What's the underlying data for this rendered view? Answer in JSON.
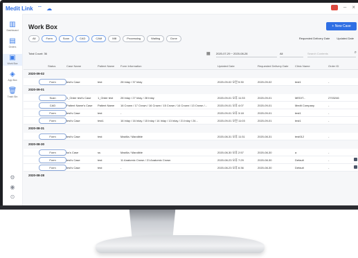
{
  "app": {
    "title": "Medit Link"
  },
  "window": {
    "badge": "!",
    "minimize": "–",
    "close": "×"
  },
  "sidebar": {
    "items": [
      {
        "icon": "dashboard-icon",
        "label": "Dashboard"
      },
      {
        "icon": "orders-icon",
        "label": "Orders"
      },
      {
        "icon": "work-box-icon",
        "label": "Work Box"
      },
      {
        "icon": "app-box-icon",
        "label": "App Box"
      },
      {
        "icon": "trash-icon",
        "label": "Trash Bin"
      }
    ]
  },
  "page": {
    "title": "Work Box",
    "new_case_label": "+ New Case"
  },
  "filters": [
    "All",
    "Form",
    "Scan",
    "CAD",
    "CAM",
    "Mill",
    "Processing",
    "Waiting",
    "Done"
  ],
  "sort": {
    "delivery": "Requested Delivery Date",
    "updated": "Updated Date"
  },
  "toolbar": {
    "total_count": "Total Count: 36",
    "date_range": "2020-07-29 ~ 2020-08-28",
    "scope": "All",
    "search_placeholder": "Search Contents"
  },
  "columns": [
    "Status",
    "Case Name",
    "Patient Name",
    "Form Information",
    "Updated Date",
    "Requested Delivery Date",
    "Clinic Name",
    "Order ID"
  ],
  "groups": [
    {
      "date": "2020-09-02",
      "rows": [
        {
          "status": "Form",
          "case": "test's Case",
          "patient": "test",
          "form": "28 Inlay / 37 Inlay",
          "updated": "2020-09-02 오전 5:30",
          "delivery": "2020-09-02",
          "clinic": "test1",
          "order": "-",
          "icon": false
        }
      ]
    },
    {
      "date": "2020-09-01",
      "rows": [
        {
          "status": "Scan",
          "case": "1_Order test's Case",
          "patient": "1_Order test",
          "form": "28 Inlay / 27 Inlay / 28 Inlay",
          "updated": "2020-09-01 오후 11:33",
          "delivery": "2020-09-01",
          "clinic": "MEDIT...",
          "order": "2703246",
          "icon": false
        },
        {
          "status": "CAD",
          "case": "Patient Name's Case",
          "patient": "Patient Name",
          "form": "16 Crown / 17 Crown / 16 Crown / 15 Crown / 14 Crown / 13 Crown /...",
          "updated": "2020-09-01 오후 4:07",
          "delivery": "2020-09-01",
          "clinic": "Medit Company",
          "order": "-",
          "icon": false
        },
        {
          "status": "Form",
          "case": "test's Case",
          "patient": "test",
          "form": "-",
          "updated": "2020-09-01 오후 3:18",
          "delivery": "2020-09-01",
          "clinic": "test1",
          "order": "-",
          "icon": false
        },
        {
          "status": "Form",
          "case": "test's Case",
          "patient": "test1",
          "form": "16 Inlay / 16 Inlay / 15 Inlay / 14 Inlay / 13 Inlay / 21 Inlay / 24...",
          "updated": "2020-09-01 오전 11:03",
          "delivery": "2020-09-01",
          "clinic": "test1",
          "order": "-",
          "icon": false
        }
      ]
    },
    {
      "date": "2020-08-31",
      "rows": [
        {
          "status": "Form",
          "case": "test's Case",
          "patient": "test",
          "form": "Maxilla / Mandible",
          "updated": "2020-08-31 오후 11:31",
          "delivery": "2020-08-31",
          "clinic": "test012",
          "order": "-",
          "icon": false
        }
      ]
    },
    {
      "date": "2020-08-30",
      "rows": [
        {
          "status": "Form",
          "case": "ss's Case",
          "patient": "ss",
          "form": "Maxilla / Mandible",
          "updated": "2020-08-30 오후 2:57",
          "delivery": "2020-08-30",
          "clinic": "a",
          "order": "-",
          "icon": false
        },
        {
          "status": "Form",
          "case": "test's Case",
          "patient": "test",
          "form": "11 Anatomic Crown / 21 Anatomic Crown",
          "updated": "2020-08-23 오후 7:29",
          "delivery": "2020-08-30",
          "clinic": "Default",
          "order": "-",
          "icon": true
        },
        {
          "status": "Form",
          "case": "test's Case",
          "patient": "test",
          "form": "-",
          "updated": "2020-08-23 오후 6:36",
          "delivery": "2020-08-30",
          "clinic": "Default",
          "order": "-",
          "icon": true
        }
      ]
    },
    {
      "date": "2020-08-28",
      "rows": []
    }
  ],
  "colors": {
    "accent": "#2f6fe4",
    "bezel": "#1e1f23",
    "background": "#f6f7f9"
  }
}
